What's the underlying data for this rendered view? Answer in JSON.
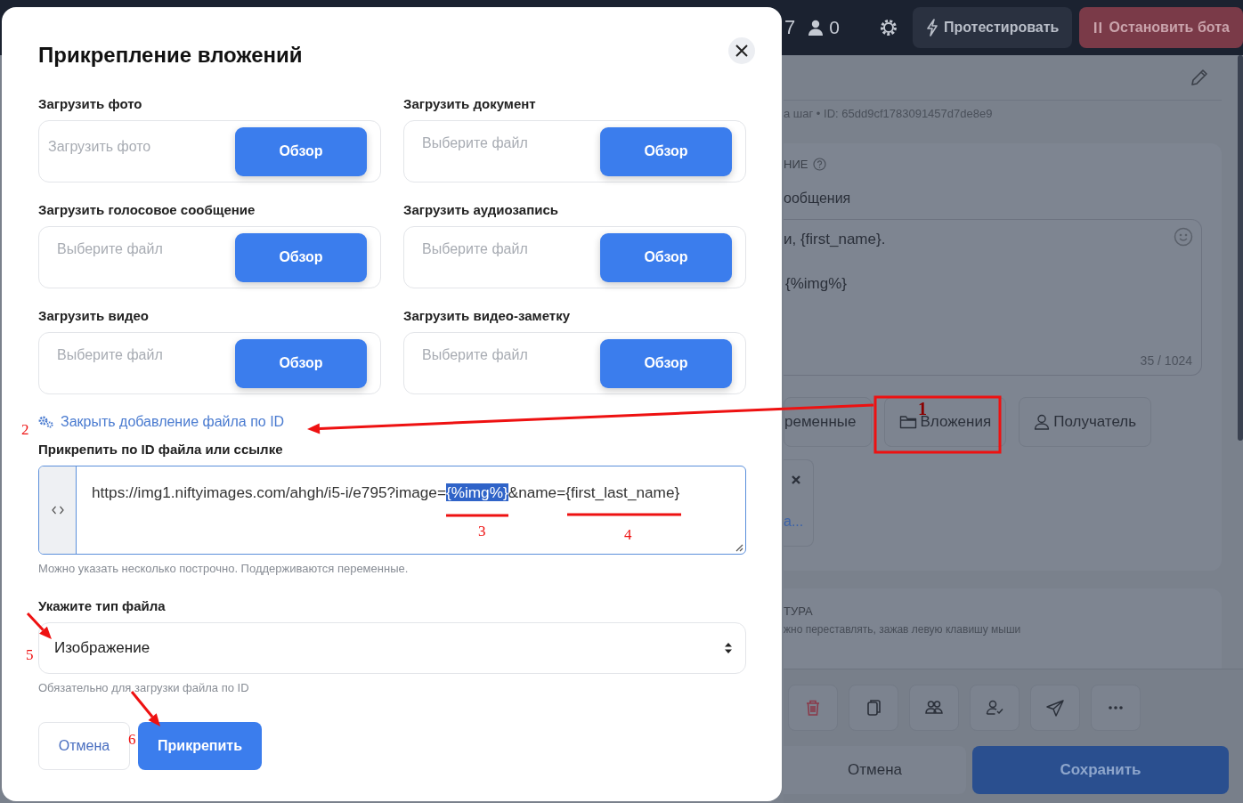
{
  "topbar": {
    "counter": "7",
    "users": "0",
    "test_button": "Протестировать",
    "stop_button": "Остановить бота"
  },
  "step": {
    "meta": "а шаг • ID: 65dd9cf1783091457d7de8e9",
    "section_title": "НИЕ",
    "field_label": "ообщения",
    "message_lines": [
      "и, {first_name}.",
      "{%img%}"
    ],
    "char_count": "35 / 1024",
    "tabs": [
      {
        "label": "ременные",
        "kind": "plain"
      },
      {
        "label": "Вложения",
        "kind": "folder"
      },
      {
        "label": "Получатель",
        "kind": "user"
      }
    ],
    "attachment_link": "а...",
    "structure_title": "ТУРА",
    "structure_hint": "жно переставлять, зажав левую клавишу мыши",
    "actions": [
      {
        "kind": "trash"
      },
      {
        "kind": "copy"
      },
      {
        "kind": "group"
      },
      {
        "kind": "user-check"
      },
      {
        "kind": "send"
      },
      {
        "kind": "more"
      }
    ],
    "cancel_button": "Отмена",
    "save_button": "Сохранить"
  },
  "modal": {
    "title": "Прикрепление вложений",
    "uploads": [
      {
        "label": "Загрузить фото",
        "placeholder": "Загрузить фото",
        "button": "Обзор"
      },
      {
        "label": "Загрузить документ",
        "placeholder": "Выберите файл",
        "button": "Обзор"
      },
      {
        "label": "Загрузить голосовое сообщение",
        "placeholder": "Выберите файл",
        "button": "Обзор"
      },
      {
        "label": "Загрузить аудиозапись",
        "placeholder": "Выберите файл",
        "button": "Обзор"
      },
      {
        "label": "Загрузить видео",
        "placeholder": "Выберите файл",
        "button": "Обзор"
      },
      {
        "label": "Загрузить видео-заметку",
        "placeholder": "Выберите файл",
        "button": "Обзор"
      }
    ],
    "toggle_link": "Закрыть добавление файла по ID",
    "url_label": "Прикрепить по ID файла или ссылке",
    "url_segments": [
      {
        "text": "https://img1.niftyimages.com/ahgh/i5-i/e795?image=",
        "selected": false
      },
      {
        "text": "{%img%}",
        "selected": true
      },
      {
        "text": "&name={first_last_name}",
        "selected": false
      }
    ],
    "url_hint": "Можно указать несколько построчно. Поддерживаются переменные.",
    "type_label": "Укажите тип файла",
    "type_value": "Изображение",
    "type_hint": "Обязательно для загрузки файла по ID",
    "cancel_button": "Отмена",
    "attach_button": "Прикрепить"
  },
  "annotations": [
    "1",
    "2",
    "3",
    "4",
    "5",
    "6"
  ]
}
